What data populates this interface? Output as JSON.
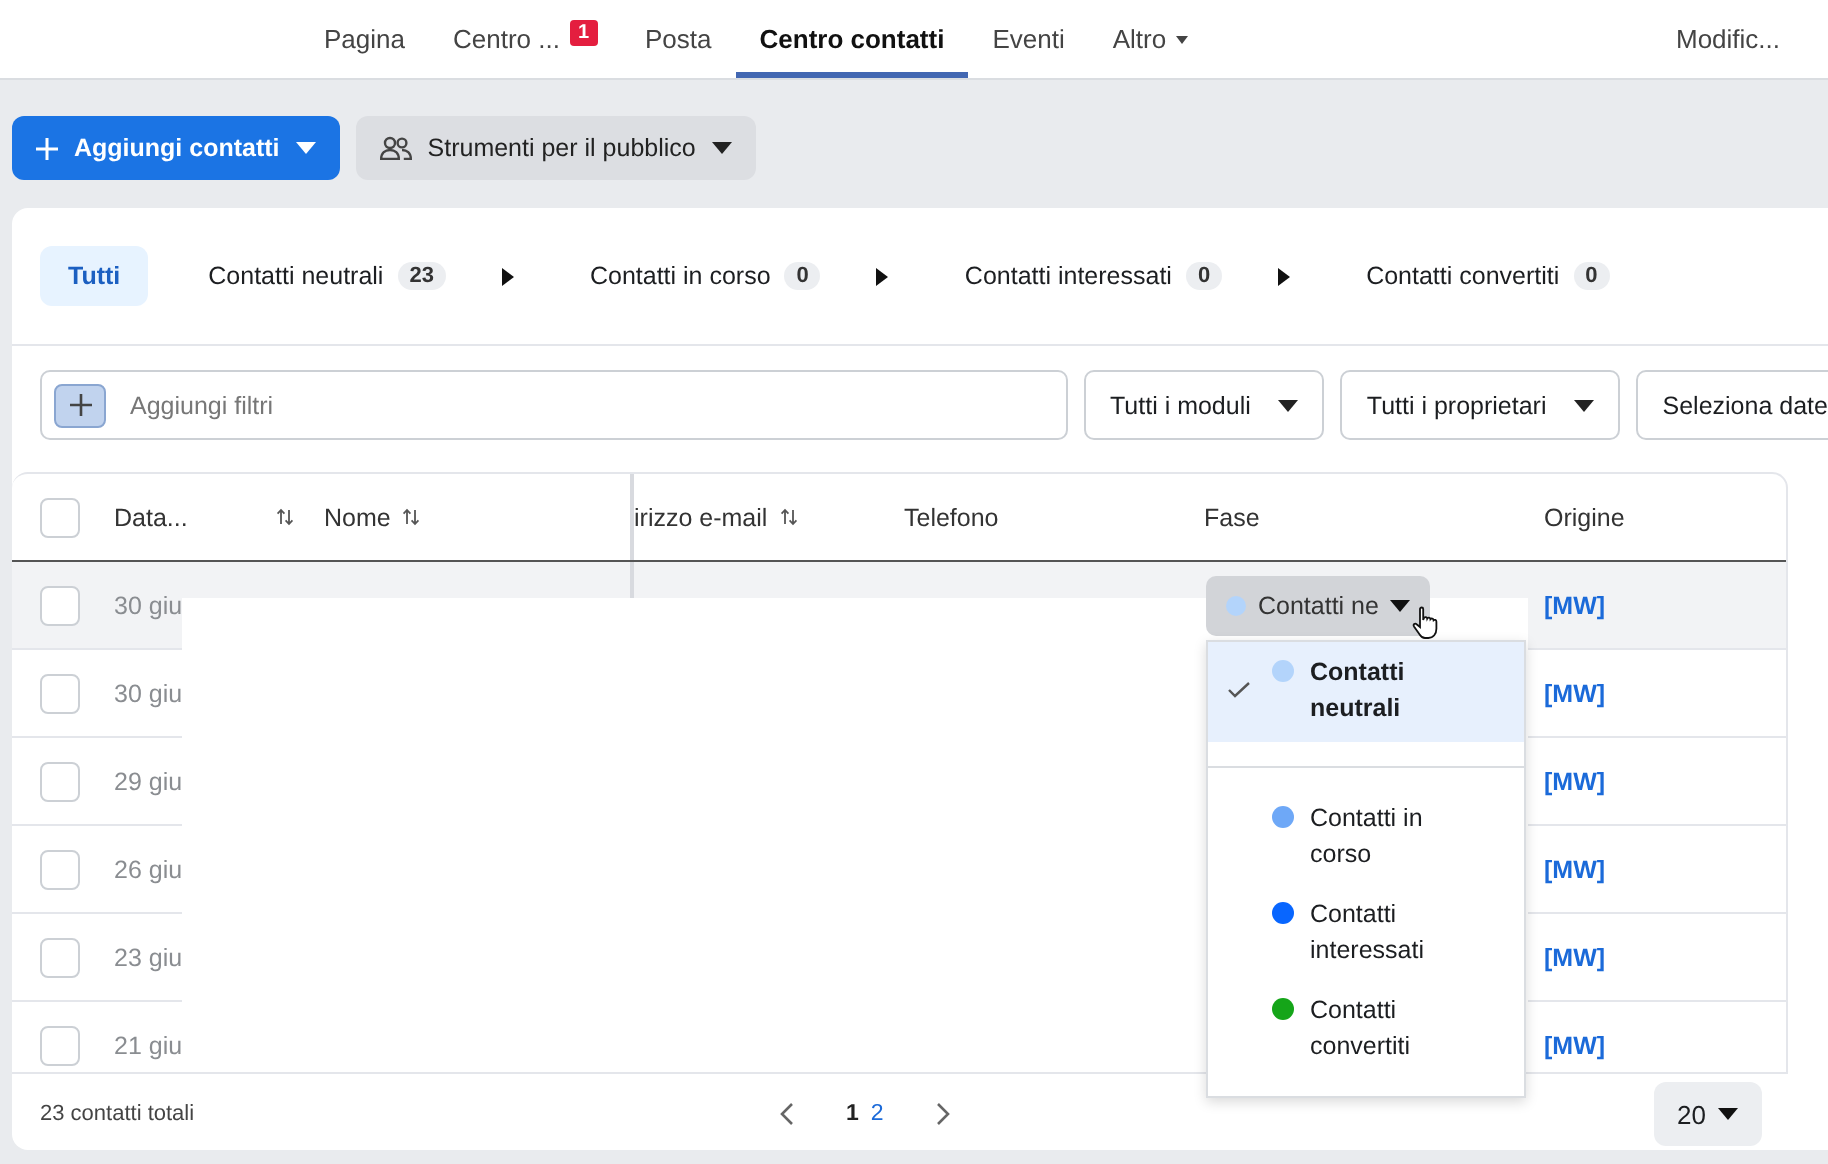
{
  "nav": {
    "items": [
      {
        "label": "Pagina",
        "selected": false
      },
      {
        "label": "Centro ...",
        "selected": false,
        "badge": "1"
      },
      {
        "label": "Posta",
        "selected": false
      },
      {
        "label": "Centro contatti",
        "selected": true
      },
      {
        "label": "Eventi",
        "selected": false
      },
      {
        "label": "Altro",
        "selected": false,
        "menu": true
      }
    ],
    "right": "Modific..."
  },
  "actions": {
    "primary": "Aggiungi contatti",
    "secondary": "Strumenti per il pubblico"
  },
  "stages": [
    {
      "label": "Tutti",
      "selected": true
    },
    {
      "label": "Contatti neutrali",
      "count": "23",
      "selected": false
    },
    {
      "label": "Contatti in corso",
      "count": "0",
      "selected": false
    },
    {
      "label": "Contatti interessati",
      "count": "0",
      "selected": false
    },
    {
      "label": "Contatti convertiti",
      "count": "0",
      "selected": false
    }
  ],
  "filters": {
    "placeholder": "Aggiungi filtri",
    "dropdowns": [
      "Tutti i moduli",
      "Tutti i proprietari",
      "Seleziona date"
    ]
  },
  "table": {
    "select_all_checked": false,
    "columns": [
      "Data...",
      "Nome",
      "irizzo e-mail",
      "Telefono",
      "Fase",
      "Origine"
    ],
    "rows": [
      {
        "date": "30 giu",
        "origin": "[MW]",
        "hovered": true,
        "phase": {
          "label": "Contatti ne",
          "color": "#b3d4fb"
        }
      },
      {
        "date": "30 giu",
        "origin": "[MW]",
        "hovered": false
      },
      {
        "date": "29 giu",
        "origin": "[MW]",
        "hovered": false
      },
      {
        "date": "26 giu",
        "origin": "[MW]",
        "hovered": false
      },
      {
        "date": "23 giu",
        "origin": "[MW]",
        "hovered": false
      },
      {
        "date": "21 giu",
        "origin": "[MW]",
        "hovered": false
      }
    ]
  },
  "phase_menu": [
    {
      "label": "Contatti neutrali",
      "color": "#b3d4fb",
      "selected": true
    },
    {
      "label": "Contatti in corso",
      "color": "#6ea8f7",
      "selected": false
    },
    {
      "label": "Contatti interessati",
      "color": "#0866ff",
      "selected": false
    },
    {
      "label": "Contatti convertiti",
      "color": "#15a519",
      "selected": false
    }
  ],
  "footer": {
    "total": "23 contatti totali",
    "pages": [
      {
        "label": "1",
        "selected": true
      },
      {
        "label": "2",
        "selected": false
      }
    ],
    "page_size": "20"
  }
}
